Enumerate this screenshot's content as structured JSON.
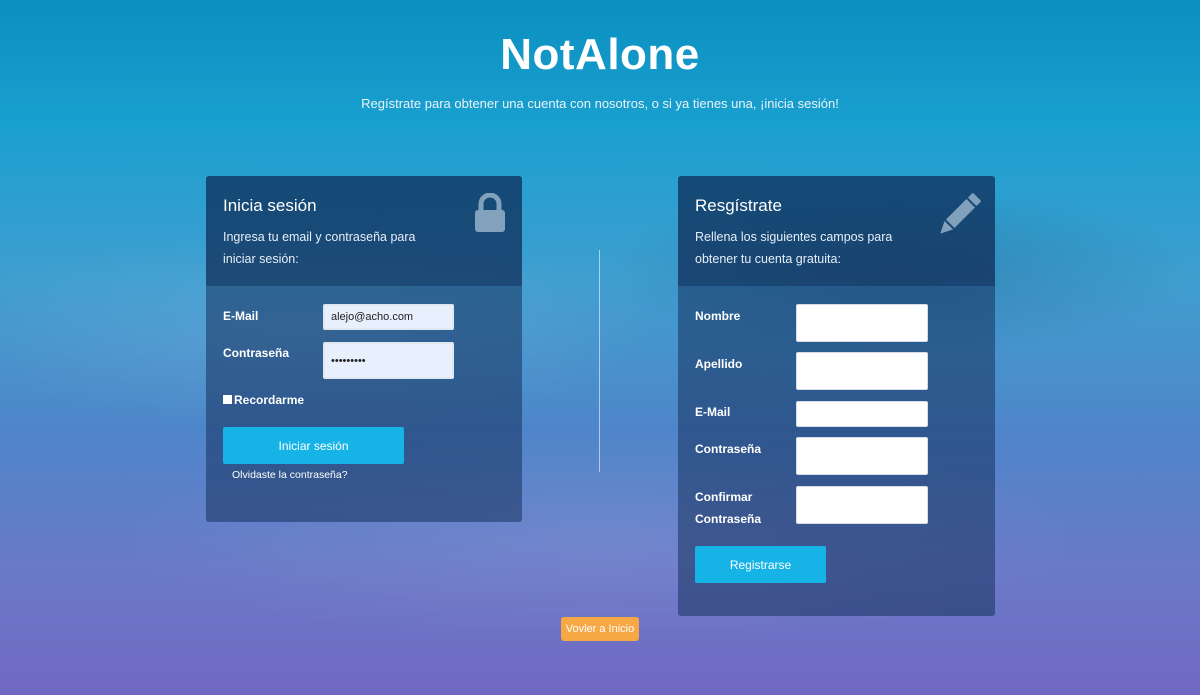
{
  "header": {
    "title": "NotAlone",
    "subtitle": "Regístrate para obtener una cuenta con nosotros, o si ya tienes una, ¡inicia sesión!"
  },
  "login": {
    "title": "Inicia sesión",
    "description": "Ingresa tu email y contraseña para iniciar sesión:",
    "icon": "lock-icon",
    "email_label": "E-Mail",
    "email_value": "alejo@acho.com",
    "password_label": "Contraseña",
    "password_value": "•••••••••",
    "remember_label": "Recordarme",
    "submit_label": "Iniciar sesión",
    "forgot_label": "Olvidaste la contraseña?"
  },
  "register": {
    "title": "Resgístrate",
    "description": "Rellena los siguientes campos para obtener tu cuenta gratuita:",
    "icon": "pencil-icon",
    "name_label": "Nombre",
    "lastname_label": "Apellido",
    "email_label": "E-Mail",
    "password_label": "Contraseña",
    "confirm_label": "Confirmar Contraseña",
    "submit_label": "Registrarse"
  },
  "footer": {
    "back_label": "Vovler a Inicio"
  },
  "colors": {
    "primary_button": "#16b4e6",
    "back_button": "#f7a744"
  }
}
